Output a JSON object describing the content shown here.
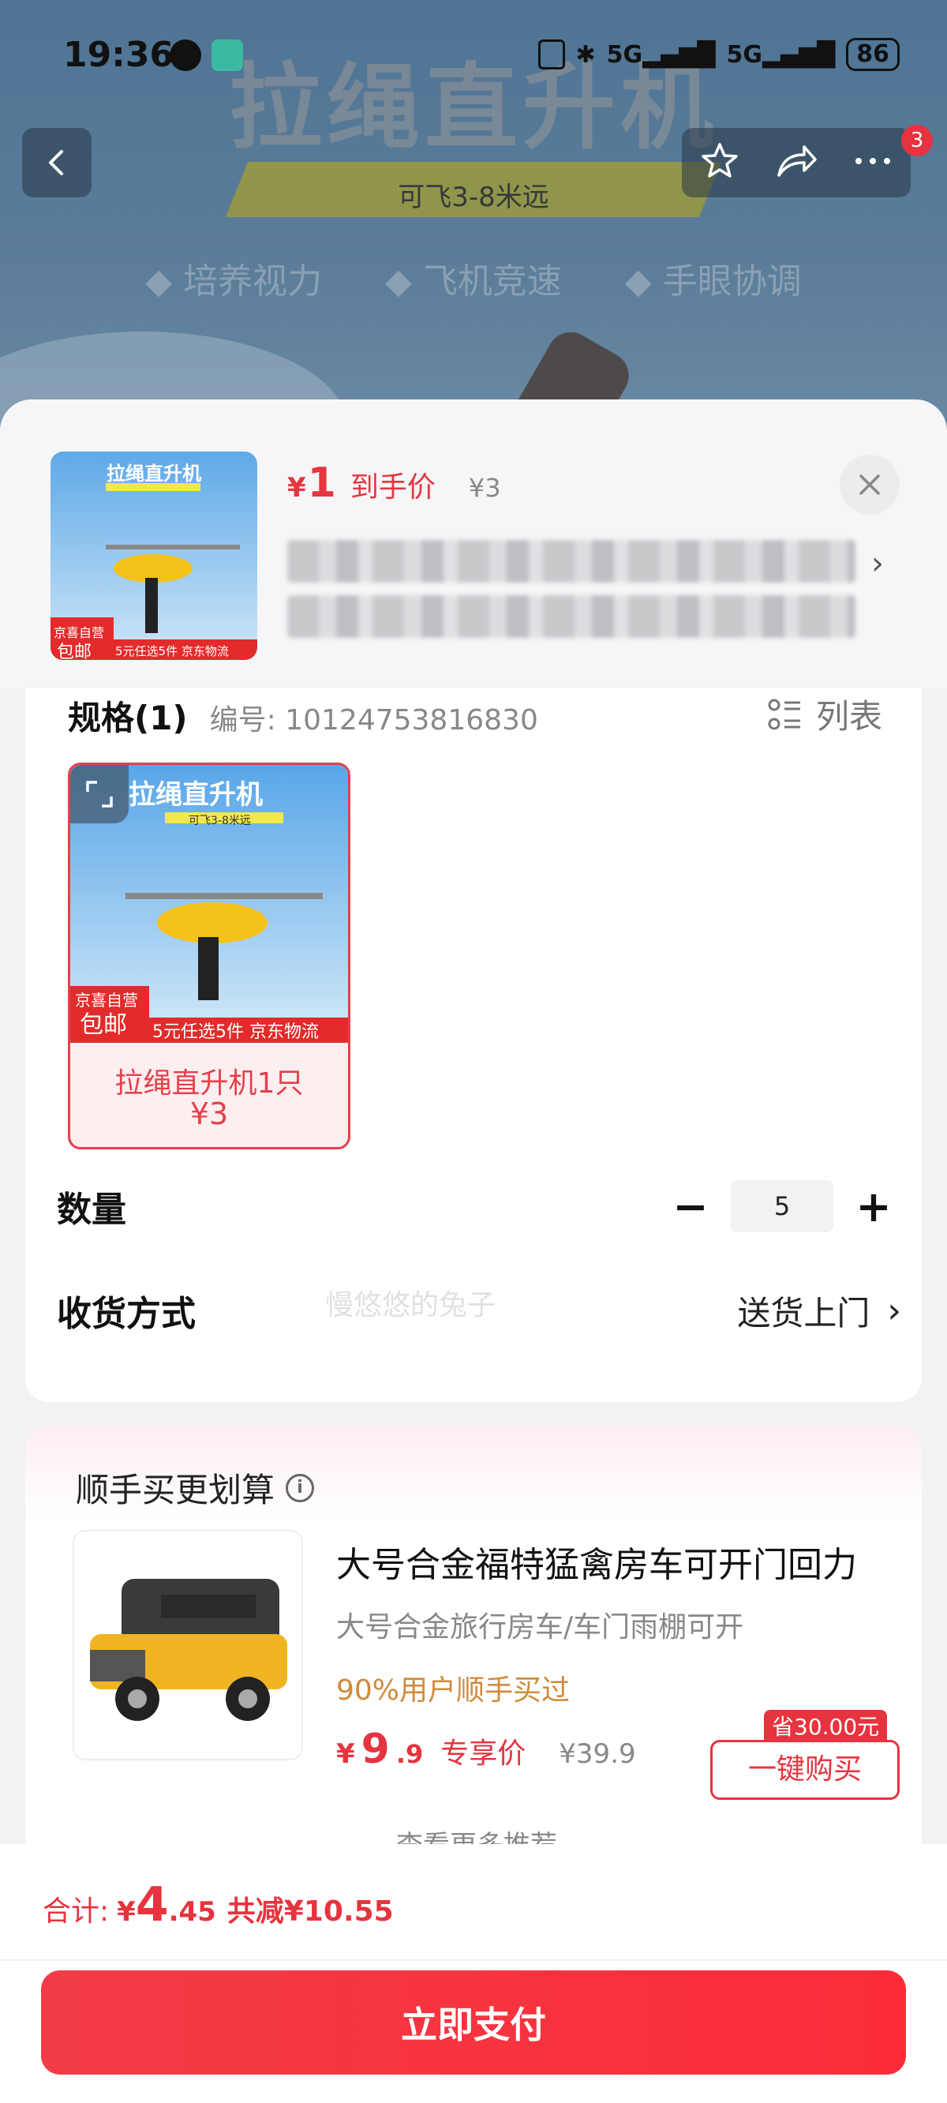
{
  "status": {
    "time": "19:36",
    "battery": "86",
    "network": "5G"
  },
  "nav": {
    "badge": "3"
  },
  "banner": {
    "title": "拉绳直升机",
    "strip": "可飞3-8米远",
    "tags": [
      "◆ 培养视力",
      "◆ 飞机竞速",
      "◆ 手眼协调"
    ]
  },
  "header": {
    "price_currency": "¥",
    "price": "1",
    "price_label": "到手价",
    "original_price": "¥3"
  },
  "spec": {
    "title": "规格(1)",
    "code": "编号: 10124753816830",
    "list_toggle": "列表",
    "option": {
      "name": "拉绳直升机1只",
      "price": "¥3"
    },
    "thumb_title": "拉绳直升机",
    "thumb_sub": "可飞3-8米远",
    "thumb_badge_top": "京喜自营",
    "thumb_badge_main": "包邮",
    "thumb_promo": "5元任选5件 京东物流"
  },
  "watermark": "慢悠悠的兔子",
  "quantity": {
    "label": "数量",
    "value": "5",
    "minus": "−",
    "plus": "+"
  },
  "shipping": {
    "label": "收货方式",
    "value": "送货上门"
  },
  "upsell": {
    "title": "顺手买更划算",
    "info": "i",
    "name": "大号合金福特猛禽房车可开门回力",
    "sub": "大号合金旅行房车/车门雨棚可开",
    "hint": "90%用户顺手买过",
    "price_currency": "¥",
    "price_int": "9",
    "price_dec": ".9",
    "price_label": "专享价",
    "original_price": "¥39.9",
    "save_tag": "省30.00元",
    "buy_button": "一键购买",
    "more": "查看更多推荐"
  },
  "footer": {
    "total_label": "合计:",
    "total_currency": "¥",
    "total_int": "4",
    "total_dec": ".45",
    "total_save": "共减¥10.55",
    "pay_button": "立即支付"
  },
  "colors": {
    "accent": "#e5343f",
    "hint": "#d08a3a",
    "sheet_bg": "#f2f2f4"
  }
}
